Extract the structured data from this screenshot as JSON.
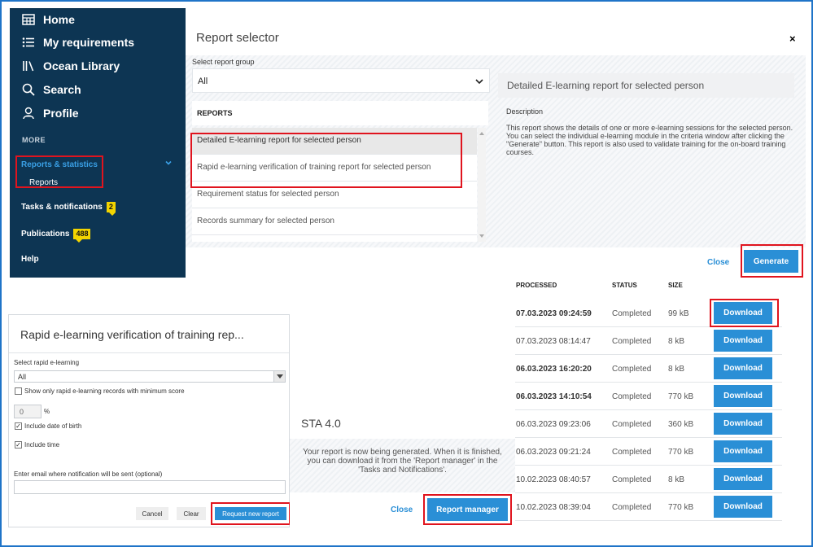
{
  "sidebar": {
    "items": [
      {
        "label": "Home",
        "icon": "home-grid-icon"
      },
      {
        "label": "My requirements",
        "icon": "list-icon"
      },
      {
        "label": "Ocean Library",
        "icon": "library-icon"
      },
      {
        "label": "Search",
        "icon": "search-icon"
      },
      {
        "label": "Profile",
        "icon": "profile-icon"
      }
    ],
    "more_label": "MORE",
    "reports_statistics": "Reports & statistics",
    "reports": "Reports",
    "tasks_notifications": "Tasks & notifications",
    "tasks_badge": "2",
    "publications": "Publications",
    "publications_badge": "488",
    "help": "Help",
    "accent_color": "#3aa0e6",
    "bg_color": "#0d3553"
  },
  "report_selector": {
    "title": "Report selector",
    "close_glyph": "×",
    "group_label": "Select report group",
    "group_value": "All",
    "reports_header": "REPORTS",
    "reports": [
      "Detailed E-learning report for selected person",
      "Rapid e-learning verification of training report for selected person",
      "Requirement status for selected person",
      "Records summary for selected person"
    ],
    "selected_report_title": "Detailed E-learning report for selected person",
    "description_label": "Description",
    "description": "This report shows the details of one or more e-learning sessions for the selected person. You can select the individual e-learning module in the criteria window after clicking the \"Generate\" button. This report is also used to validate training for the on-board training courses.",
    "close_label": "Close",
    "generate_label": "Generate"
  },
  "processed_table": {
    "headers": {
      "processed": "PROCESSED",
      "status": "STATUS",
      "size": "SIZE"
    },
    "rows": [
      {
        "date": "07.03.2023 09:24:59",
        "status": "Completed",
        "size": "99 kB",
        "action": "Download",
        "bold": true
      },
      {
        "date": "07.03.2023 08:14:47",
        "status": "Completed",
        "size": "8 kB",
        "action": "Download",
        "bold": false
      },
      {
        "date": "06.03.2023 16:20:20",
        "status": "Completed",
        "size": "8 kB",
        "action": "Download",
        "bold": true
      },
      {
        "date": "06.03.2023 14:10:54",
        "status": "Completed",
        "size": "770 kB",
        "action": "Download",
        "bold": true
      },
      {
        "date": "06.03.2023 09:23:06",
        "status": "Completed",
        "size": "360 kB",
        "action": "Download",
        "bold": false
      },
      {
        "date": "06.03.2023 09:21:24",
        "status": "Completed",
        "size": "770 kB",
        "action": "Download",
        "bold": false
      },
      {
        "date": "10.02.2023 08:40:57",
        "status": "Completed",
        "size": "8 kB",
        "action": "Download",
        "bold": false
      },
      {
        "date": "10.02.2023 08:39:04",
        "status": "Completed",
        "size": "770 kB",
        "action": "Download",
        "bold": false
      }
    ]
  },
  "rapid_panel": {
    "title": "Rapid e-learning verification of training rep...",
    "select_label": "Select rapid e-learning",
    "select_value": "All",
    "min_score_label": "Show only rapid e-learning records with minimum score",
    "score_value": "0",
    "score_unit": "%",
    "dob_label": "Include date of birth",
    "time_label": "Include time",
    "email_label": "Enter email where notification will be sent (optional)",
    "email_value": "",
    "cancel_label": "Cancel",
    "clear_label": "Clear",
    "request_label": "Request new report",
    "checked_glyph": "✓"
  },
  "sta_modal": {
    "title": "STA 4.0",
    "message": "Your report is now being generated. When it is finished, you can download it from the 'Report manager' in the 'Tasks and Notifications'.",
    "close_label": "Close",
    "report_manager_label": "Report manager"
  },
  "colors": {
    "primary_button": "#2a8fd6",
    "highlight_outline": "#e0141e",
    "badge": "#f2d400"
  }
}
